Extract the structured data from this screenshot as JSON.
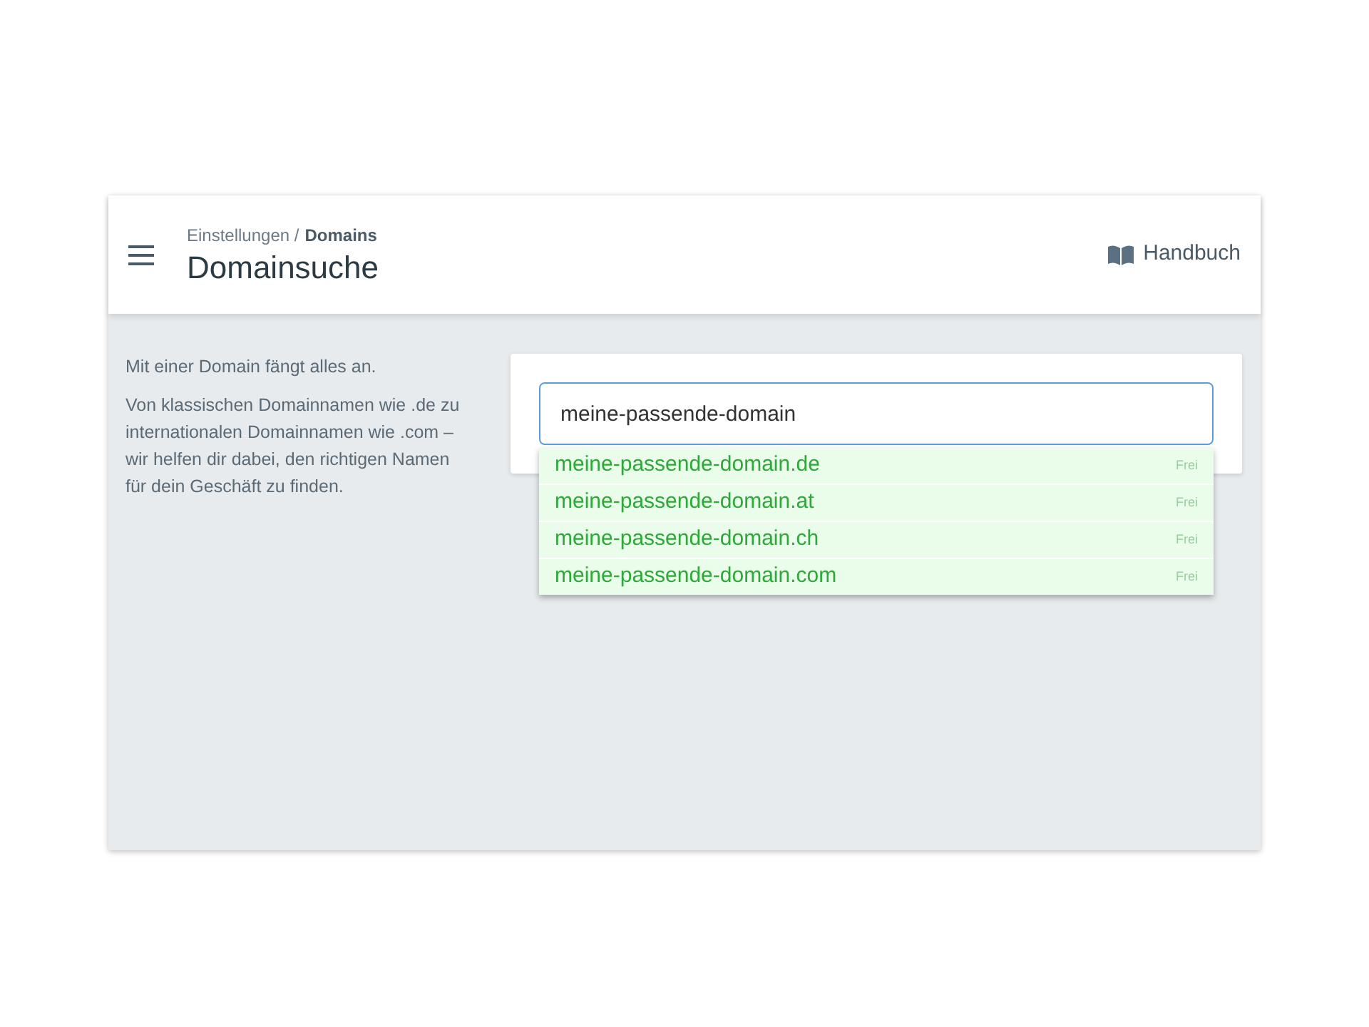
{
  "header": {
    "breadcrumb": {
      "parent": "Einstellungen /",
      "current": "Domains"
    },
    "title": "Domainsuche",
    "manual_link": "Handbuch"
  },
  "intro": {
    "lead": "Mit einer Domain fängt alles an.",
    "text": "Von klassischen Domainnamen wie .de zu internationalen Domainnamen wie .com – wir helfen dir dabei, den richtigen Namen für dein Geschäft zu finden."
  },
  "search": {
    "value": "meine-passende-domain"
  },
  "suggestions": [
    {
      "domain": "meine-passende-domain.de",
      "status": "Frei",
      "available": true
    },
    {
      "domain": "meine-passende-domain.at",
      "status": "Frei",
      "available": true
    },
    {
      "domain": "meine-passende-domain.ch",
      "status": "Frei",
      "available": true
    },
    {
      "domain": "meine-passende-domain.com",
      "status": "Frei",
      "available": true
    }
  ]
}
